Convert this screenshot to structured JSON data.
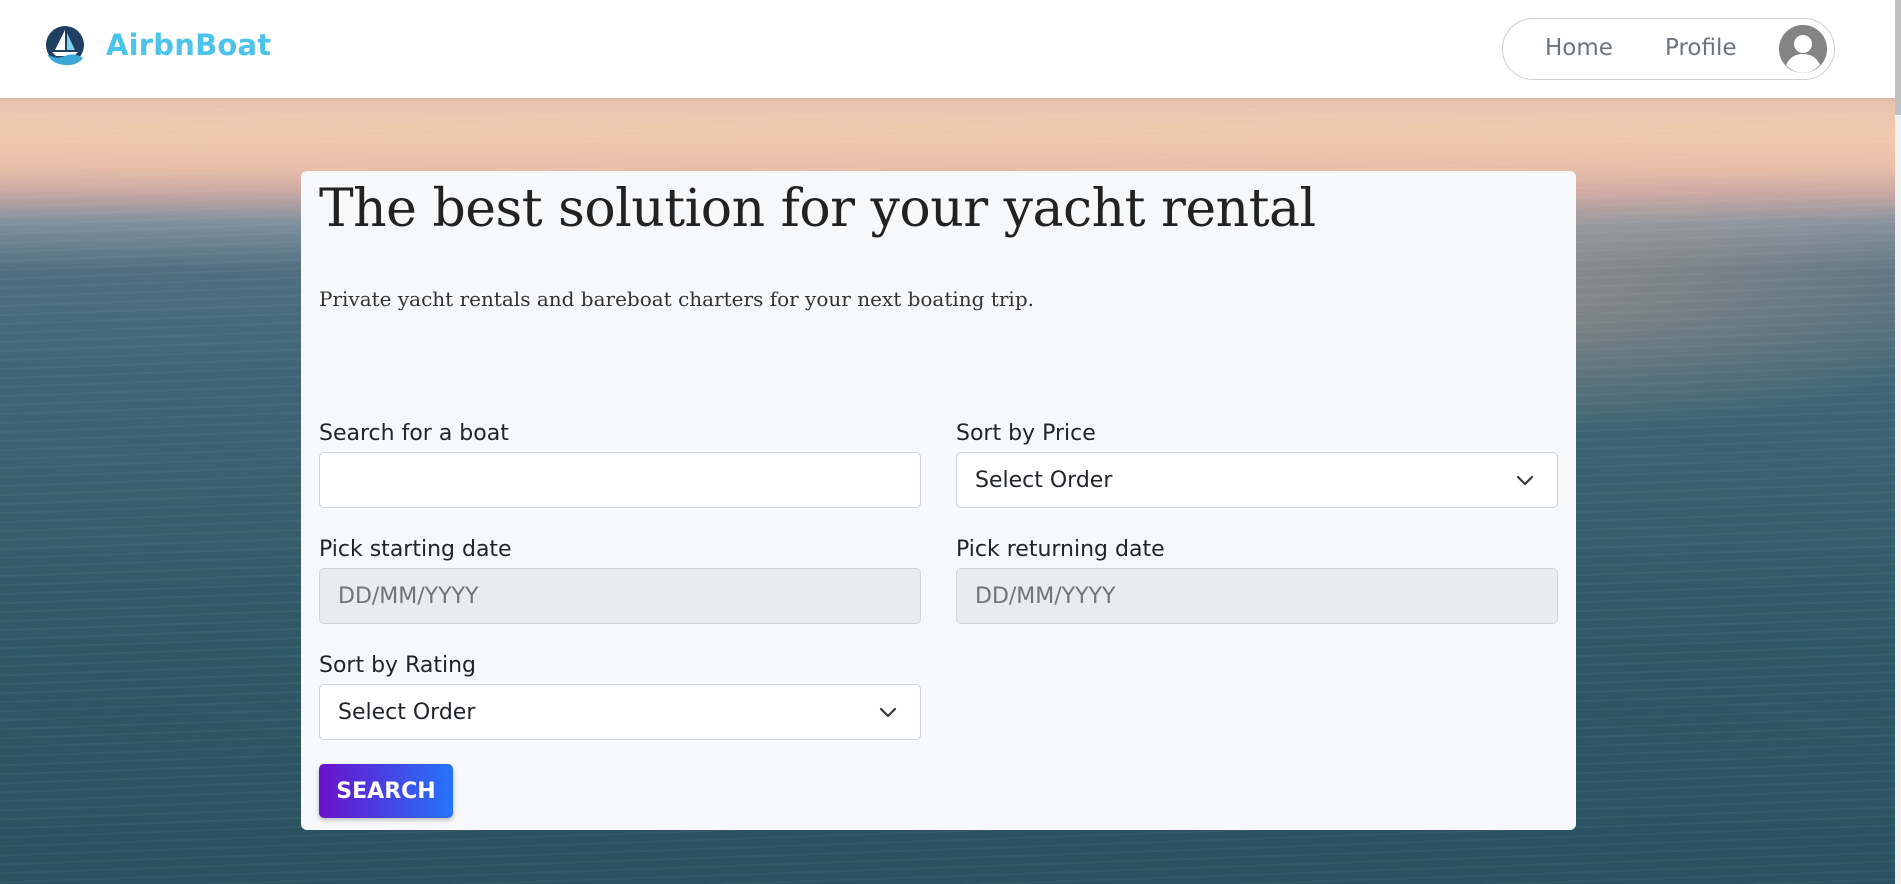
{
  "navbar": {
    "brand_name": "AirbnBoat",
    "brand_color": "#4cc3ea",
    "links": {
      "home": "Home",
      "profile": "Profile"
    },
    "avatar_icon": "user-circle-icon",
    "logo_icon": "sailboat-logo-icon"
  },
  "hero": {
    "title": "The best solution for your yacht rental",
    "subtitle": "Private yacht rentals and bareboat charters for your next boating trip."
  },
  "form": {
    "search": {
      "label": "Search for a boat",
      "value": ""
    },
    "sort_price": {
      "label": "Sort by Price",
      "selected": "Select Order"
    },
    "start_date": {
      "label": "Pick starting date",
      "placeholder": "DD/MM/YYYY"
    },
    "return_date": {
      "label": "Pick returning date",
      "placeholder": "DD/MM/YYYY"
    },
    "sort_rating": {
      "label": "Sort by Rating",
      "selected": "Select Order"
    },
    "search_button": "SEARCH",
    "button_gradient": [
      "#6a11cb",
      "#2575fc"
    ]
  }
}
